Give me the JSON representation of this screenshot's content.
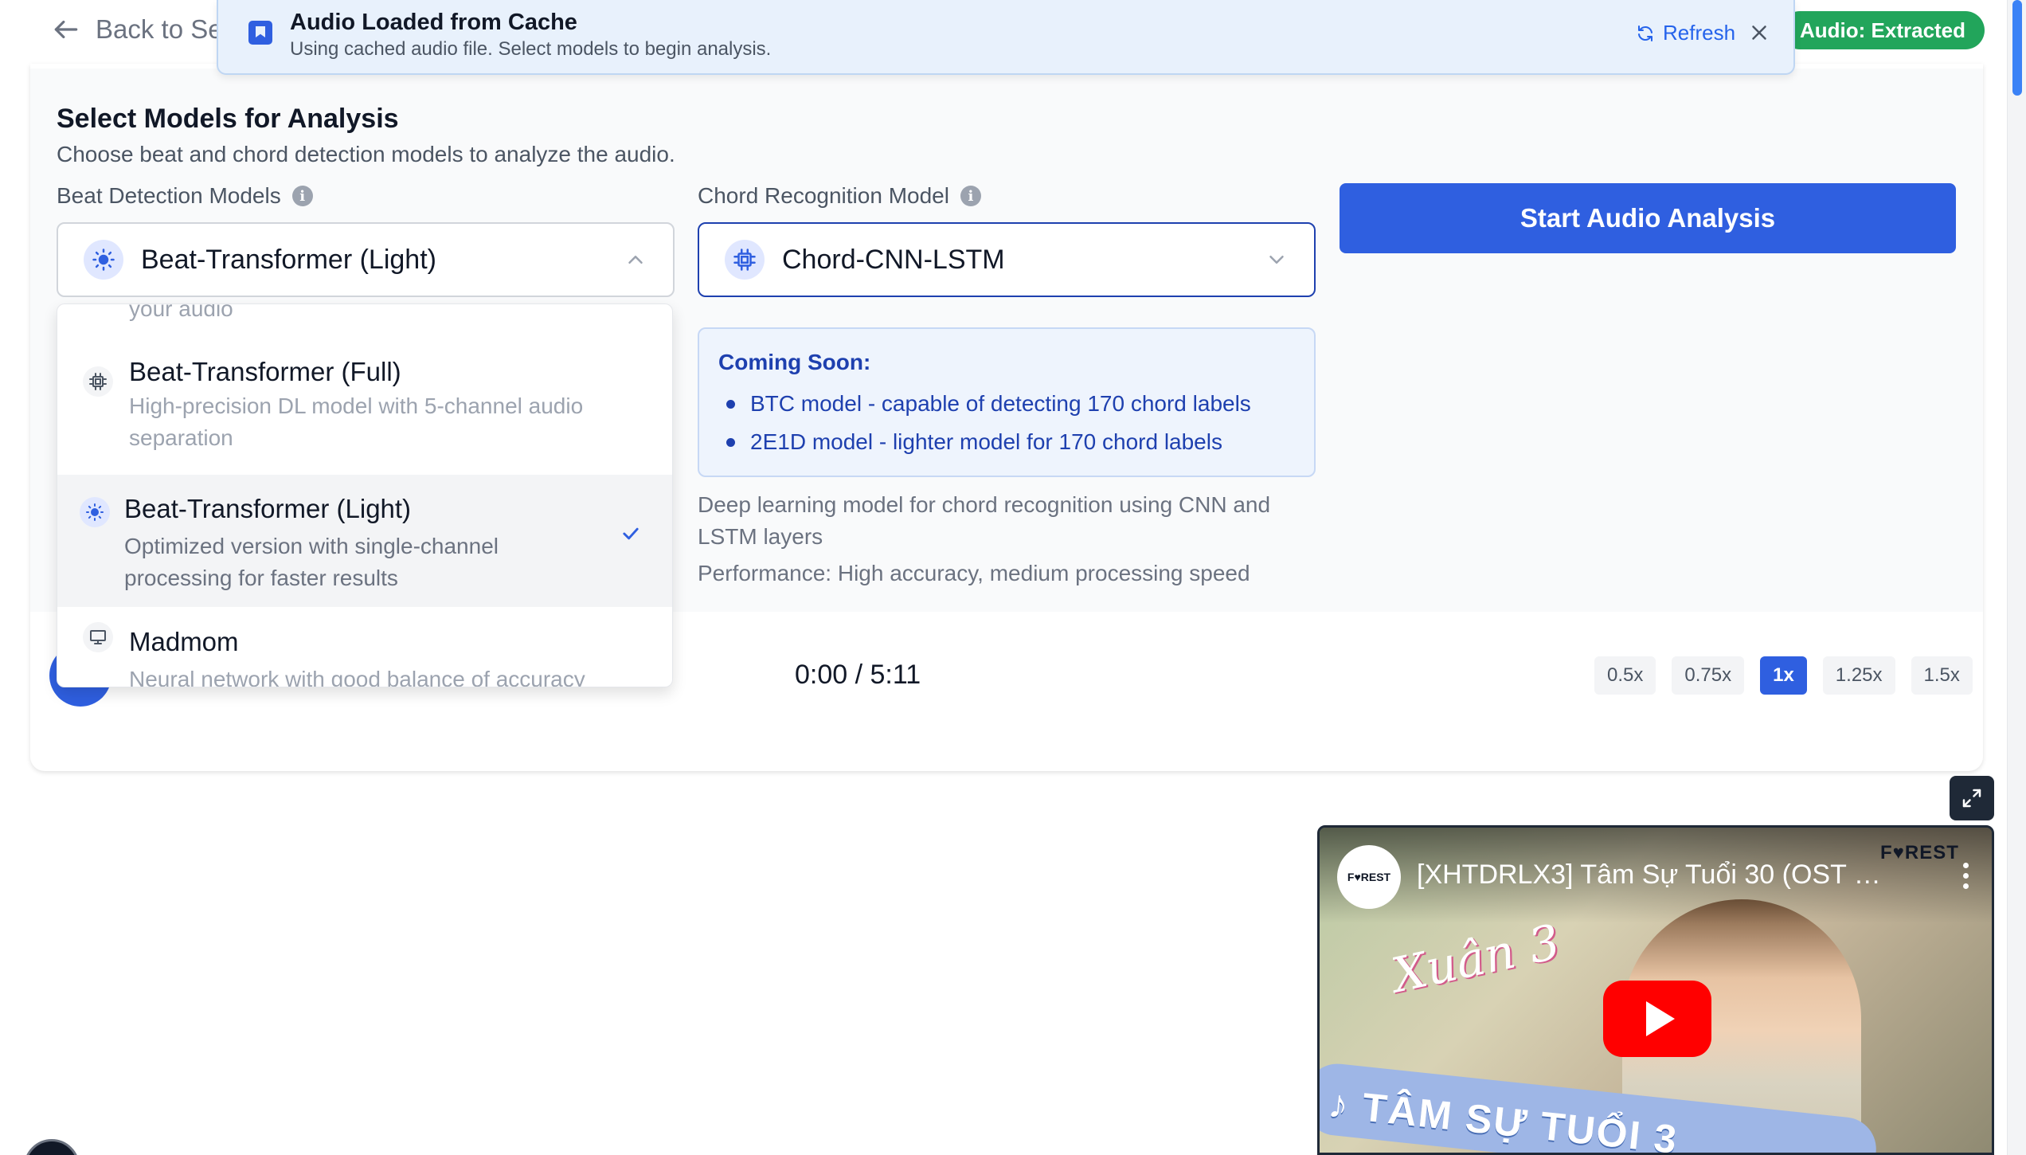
{
  "header": {
    "back_label": "Back to Se",
    "audio_badge": "Audio: Extracted"
  },
  "toast": {
    "title": "Audio Loaded from Cache",
    "message": "Using cached audio file. Select models to begin analysis.",
    "refresh_label": "Refresh"
  },
  "analysis": {
    "title": "Select Models for Analysis",
    "subtitle": "Choose beat and chord detection models to analyze the audio.",
    "beat_label": "Beat Detection Models",
    "beat_selected": "Beat-Transformer (Light)",
    "chord_label": "Chord Recognition Model",
    "chord_selected": "Chord-CNN-LSTM",
    "start_button": "Start Audio Analysis",
    "coming_soon": {
      "title": "Coming Soon:",
      "items": [
        "BTC model - capable of detecting 170 chord labels",
        "2E1D model - lighter model for 170 chord labels"
      ]
    },
    "chord_description": "Deep learning model for chord recognition using CNN and LSTM layers",
    "chord_performance": "Performance: High accuracy, medium processing speed"
  },
  "beat_dropdown": {
    "partial_text": "your audio",
    "options": [
      {
        "title": "Beat-Transformer (Full)",
        "description": "High-precision DL model with 5-channel audio separation",
        "icon": "chip-icon"
      },
      {
        "title": "Beat-Transformer (Light)",
        "description": "Optimized version with single-channel processing for faster results",
        "icon": "sun-icon",
        "selected": true
      },
      {
        "title": "Madmom",
        "description": "Neural network with good balance of accuracy",
        "icon": "monitor-icon"
      }
    ]
  },
  "player": {
    "time": "0:00 / 5:11",
    "speeds": [
      "0.5x",
      "0.75x",
      "1x",
      "1.25x",
      "1.5x"
    ],
    "active_speed": "1x"
  },
  "video": {
    "title": "[XHTDRLX3] Tâm Sự Tuổi 30 (OST Ô...",
    "channel": "F♥REST",
    "brand": "F♥REST",
    "script_text": "Xuân 3",
    "banner_text": "♪ TÂM SỰ TUỔI 3"
  },
  "colors": {
    "accent": "#2f5fe0",
    "badge": "#22a55b",
    "info_bg": "#eef4fd",
    "info_text": "#1e40af"
  }
}
